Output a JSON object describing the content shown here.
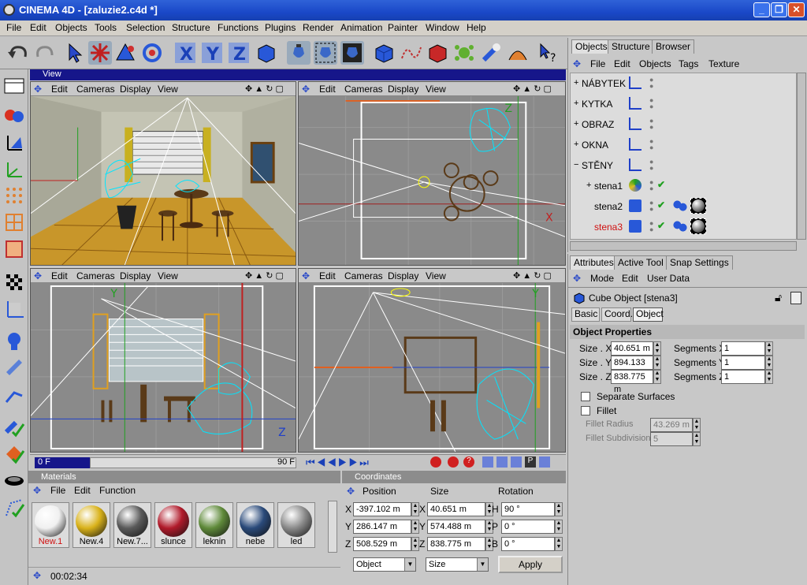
{
  "window": {
    "title": "CINEMA 4D - [zaluzie2.c4d *]",
    "controls": [
      "_",
      "❐",
      "✕"
    ]
  },
  "menubar": [
    "File",
    "Edit",
    "Objects",
    "Tools",
    "Selection",
    "Structure",
    "Functions",
    "Plugins",
    "Render",
    "Animation",
    "Painter",
    "Window",
    "Help"
  ],
  "view": {
    "title": "View",
    "viewport_menu": [
      "Edit",
      "Cameras",
      "Display",
      "View"
    ],
    "axis_labels": {
      "x": "X",
      "y": "Y",
      "z": "Z"
    }
  },
  "timeline": {
    "current": "0 F",
    "end": "90 F"
  },
  "materials": {
    "title": "Materials",
    "menu": [
      "File",
      "Edit",
      "Function"
    ],
    "items": [
      {
        "label": "New.1",
        "color": "#f0f0f0",
        "red": true
      },
      {
        "label": "New.4",
        "color": "#d9b21a",
        "red": false
      },
      {
        "label": "New.7...",
        "color": "#5a5a5a",
        "red": false
      },
      {
        "label": "slunce",
        "color": "#b01a2a",
        "red": false
      },
      {
        "label": "leknin",
        "color": "#5f8a3a",
        "red": false
      },
      {
        "label": "nebe",
        "color": "#2a4a7a",
        "red": false
      },
      {
        "label": "led",
        "color": "#8a8a8a",
        "red": false
      }
    ]
  },
  "status": {
    "time": "00:02:34"
  },
  "coordinates": {
    "title": "Coordinates",
    "headers": [
      "Position",
      "Size",
      "Rotation"
    ],
    "rows": [
      {
        "pl": "X",
        "pv": "-397.102 m",
        "sl": "X",
        "sv": "40.651 m",
        "rl": "H",
        "rv": "90 °"
      },
      {
        "pl": "Y",
        "pv": "286.147 m",
        "sl": "Y",
        "sv": "574.488 m",
        "rl": "P",
        "rv": "0 °"
      },
      {
        "pl": "Z",
        "pv": "508.529 m",
        "sl": "Z",
        "sv": "838.775 m",
        "rl": "B",
        "rv": "0 °"
      }
    ],
    "mode": "Object",
    "size_mode": "Size",
    "apply": "Apply"
  },
  "object_manager": {
    "tabs": [
      "Objects",
      "Structure",
      "Browser"
    ],
    "menu": [
      "File",
      "Edit",
      "Objects",
      "Tags",
      "Texture"
    ],
    "objects": [
      {
        "name": "NÁBYTEK",
        "expander": "+",
        "indent": 0,
        "red": false
      },
      {
        "name": "KYTKA",
        "expander": "+",
        "indent": 0,
        "red": false
      },
      {
        "name": "OBRAZ",
        "expander": "+",
        "indent": 0,
        "red": false
      },
      {
        "name": "OKNA",
        "expander": "+",
        "indent": 0,
        "red": false
      },
      {
        "name": "STĚNY",
        "expander": "−",
        "indent": 0,
        "red": false
      },
      {
        "name": "stena1",
        "expander": "+",
        "indent": 1,
        "red": false
      },
      {
        "name": "stena2",
        "expander": "",
        "indent": 1,
        "red": false
      },
      {
        "name": "stena3",
        "expander": "",
        "indent": 1,
        "red": true
      }
    ]
  },
  "attributes": {
    "tabs": [
      "Attributes",
      "Active Tool",
      "Snap Settings"
    ],
    "menu": [
      "Mode",
      "Edit",
      "User Data"
    ],
    "object_title": "Cube Object [stena3]",
    "subtabs": [
      "Basic",
      "Coord.",
      "Object"
    ],
    "section": "Object Properties",
    "size_x_label": "Size . X",
    "size_x": "40.651 m",
    "size_y_label": "Size . Y",
    "size_y": "894.133 m",
    "size_z_label": "Size . Z",
    "size_z": "838.775 m",
    "seg_x_label": "Segments X",
    "seg_x": "1",
    "seg_y_label": "Segments Y",
    "seg_y": "1",
    "seg_z_label": "Segments Z",
    "seg_z": "1",
    "separate": "Separate Surfaces",
    "fillet": "Fillet",
    "fillet_radius_label": "Fillet Radius",
    "fillet_radius": "43.269 m",
    "fillet_sub_label": "Fillet Subdivision",
    "fillet_sub": "5"
  },
  "colors": {
    "accent": "#16168a",
    "titlebar": "#1a48c8",
    "wire": "#00e5ff",
    "vpbg": "#8a8a8a"
  }
}
